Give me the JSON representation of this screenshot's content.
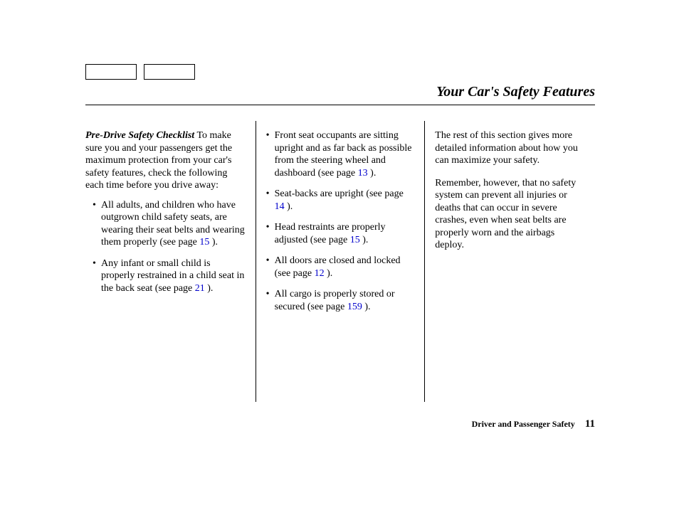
{
  "header": {
    "title": "Your Car's Safety Features"
  },
  "col1": {
    "subheading": "Pre-Drive Safety Checklist",
    "intro": "To make sure you and your passengers get the maximum protection from your car's safety features, check the following each time before you drive away:",
    "items": [
      {
        "pre": "All adults, and children who have outgrown child safety seats, are wearing their seat belts and wearing them properly (see page ",
        "page": "15",
        "post": " )."
      },
      {
        "pre": "Any infant or small child is properly restrained in a child seat in the back seat (see page ",
        "page": "21",
        "post": " )."
      }
    ]
  },
  "col2": {
    "items": [
      {
        "pre": "Front seat occupants are sitting upright and as far back as possible from the steering wheel and dashboard (see page ",
        "page": "13",
        "post": " )."
      },
      {
        "pre": "Seat-backs are upright (see page ",
        "page": "14",
        "post": " )."
      },
      {
        "pre": "Head restraints are properly adjusted (see page ",
        "page": "15",
        "post": " )."
      },
      {
        "pre": "All doors are closed and locked (see page ",
        "page": "12",
        "post": " )."
      },
      {
        "pre": "All cargo is properly stored or secured (see page ",
        "page": "159",
        "post": " )."
      }
    ]
  },
  "col3": {
    "p1": "The rest of this section gives more detailed information about how you can maximize your safety.",
    "p2": "Remember, however, that no safety system can prevent all injuries or deaths that can occur in severe crashes, even when seat belts are properly worn and the airbags deploy."
  },
  "footer": {
    "section": "Driver and Passenger Safety",
    "page": "11"
  }
}
